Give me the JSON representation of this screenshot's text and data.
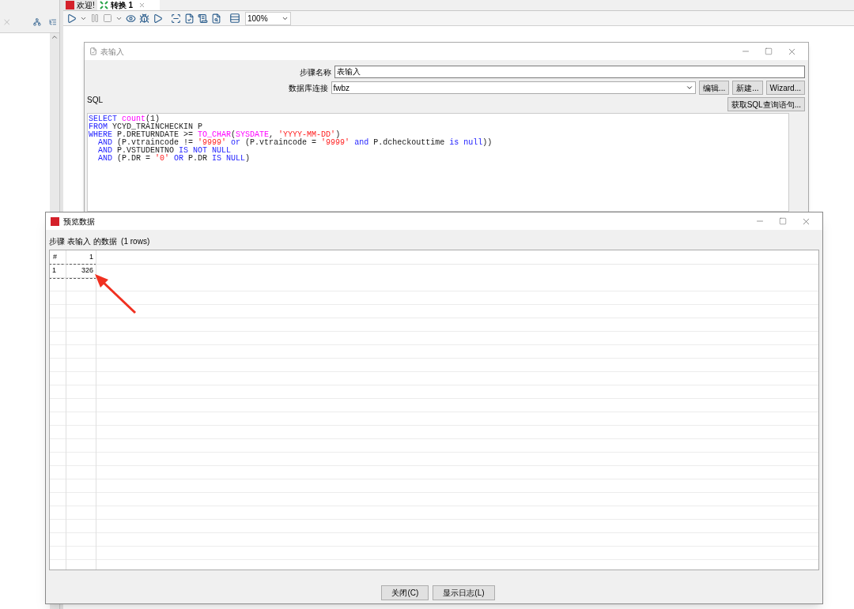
{
  "editor_tabs": [
    {
      "label": "欢迎!",
      "selected": false,
      "kind": "welcome"
    },
    {
      "label": "转换 1",
      "selected": true,
      "kind": "transform"
    }
  ],
  "zoom": {
    "value": "100%"
  },
  "step_dialog": {
    "title": "表输入",
    "fields": [
      {
        "label": "步骤名称",
        "value": "表输入",
        "kind": "text"
      },
      {
        "label": "数据库连接",
        "value": "fwbz",
        "kind": "select"
      }
    ],
    "buttons": [
      "编辑...",
      "新建...",
      "Wizard..."
    ],
    "sql_label": "SQL",
    "sql_button": "获取SQL查询语句...",
    "sql_lines": [
      [
        {
          "kind": "keyword",
          "text": "SELECT"
        },
        {
          "kind": "function",
          "text": " count"
        },
        {
          "kind": "plain",
          "text": "(1)"
        }
      ],
      [
        {
          "kind": "keyword",
          "text": "FROM"
        },
        {
          "kind": "plain",
          "text": " YCYD_TRAINCHECKIN P"
        }
      ],
      [
        {
          "kind": "keyword",
          "text": "WHERE"
        },
        {
          "kind": "plain",
          "text": " P.DRETURNDATE >= "
        },
        {
          "kind": "function",
          "text": "TO_CHAR"
        },
        {
          "kind": "plain",
          "text": "("
        },
        {
          "kind": "function",
          "text": "SYSDATE"
        },
        {
          "kind": "plain",
          "text": ", "
        },
        {
          "kind": "string",
          "text": "'YYYY-MM-DD'"
        },
        {
          "kind": "plain",
          "text": ")"
        }
      ],
      [
        {
          "kind": "keyword",
          "text": "  AND"
        },
        {
          "kind": "plain",
          "text": " (P.vtraincode != "
        },
        {
          "kind": "string",
          "text": "'9999'"
        },
        {
          "kind": "keyword",
          "text": " or"
        },
        {
          "kind": "plain",
          "text": " (P.vtraincode = "
        },
        {
          "kind": "string",
          "text": "'9999'"
        },
        {
          "kind": "keyword",
          "text": " and"
        },
        {
          "kind": "plain",
          "text": " P.dcheckouttime "
        },
        {
          "kind": "keyword",
          "text": "is null"
        },
        {
          "kind": "plain",
          "text": "))"
        }
      ],
      [
        {
          "kind": "keyword",
          "text": "  AND"
        },
        {
          "kind": "plain",
          "text": " P.VSTUDENTNO "
        },
        {
          "kind": "keyword",
          "text": "IS NOT NULL"
        }
      ],
      [
        {
          "kind": "keyword",
          "text": "  AND"
        },
        {
          "kind": "plain",
          "text": " (P.DR = "
        },
        {
          "kind": "string",
          "text": "'0'"
        },
        {
          "kind": "keyword",
          "text": " OR"
        },
        {
          "kind": "plain",
          "text": " P.DR "
        },
        {
          "kind": "keyword",
          "text": "IS NULL"
        },
        {
          "kind": "plain",
          "text": ")"
        }
      ]
    ]
  },
  "preview_dialog": {
    "title": "预览数据",
    "caption": "步骤 表输入 的数据  (1 rows)",
    "columns": [
      "#",
      "1"
    ],
    "rows": [
      {
        "cells": [
          "1",
          "326"
        ],
        "selected": true
      }
    ],
    "buttons": [
      "关闭(C)",
      "显示日志(L)"
    ]
  }
}
